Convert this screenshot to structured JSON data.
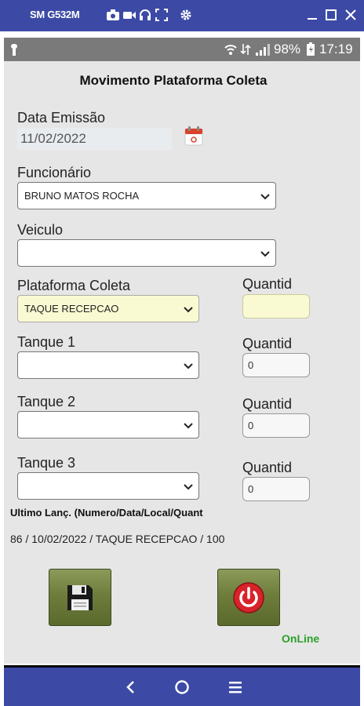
{
  "mirror_bar": {
    "device_name": "SM G532M"
  },
  "status_bar": {
    "battery_percent": "98%",
    "time": "17:19"
  },
  "form": {
    "title": "Movimento Plataforma Coleta",
    "date_label": "Data Emissão",
    "date_value": "11/02/2022",
    "employee_label": "Funcionário",
    "employee_value": "BRUNO MATOS ROCHA",
    "vehicle_label": "Veiculo",
    "vehicle_value": "",
    "platform_label": "Plataforma Coleta",
    "platform_value": "TAQUE RECEPCAO",
    "platform_qty_label": "Quantid",
    "platform_qty_value": "",
    "tanks": [
      {
        "label": "Tanque 1",
        "value": "",
        "qty_label": "Quantid",
        "qty_value": "0"
      },
      {
        "label": "Tanque 2",
        "value": "",
        "qty_label": "Quantid",
        "qty_value": "0"
      },
      {
        "label": "Tanque 3",
        "value": "",
        "qty_label": "Quantid",
        "qty_value": "0"
      }
    ],
    "last_entry_label": "Ultimo Lanç. (Numero/Data/Local/Quant",
    "last_entry_value": "86 / 10/02/2022 / TAQUE RECEPCAO / 100",
    "online_status": "OnLine"
  },
  "colors": {
    "mirror_bar": "#3c4aa6",
    "app_background": "#e6e6e6",
    "button_olive": "#6f7d3c",
    "online_green": "#2aa02a",
    "highlight_yellow": "#fafad2",
    "power_red": "#d8232a"
  },
  "icons": {
    "save_button": "floppy-disk-icon",
    "exit_button": "power-icon",
    "date_picker": "calendar-icon"
  }
}
